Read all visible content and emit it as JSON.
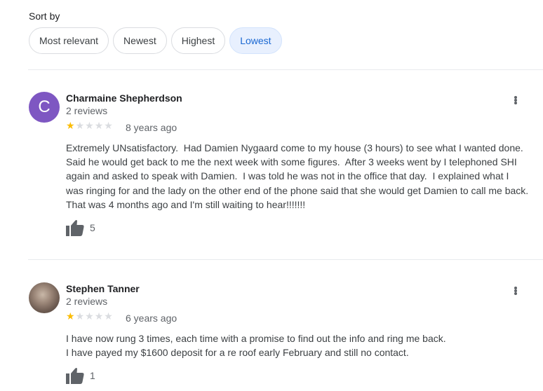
{
  "sort": {
    "label": "Sort by",
    "options": [
      "Most relevant",
      "Newest",
      "Highest",
      "Lowest"
    ],
    "selected": "Lowest"
  },
  "reviews": [
    {
      "avatar_letter": "C",
      "avatar_color": "#7e57c2",
      "name": "Charmaine Shepherdson",
      "review_count": "2 reviews",
      "rating": 1,
      "max_rating": 5,
      "date": "8 years ago",
      "text": "Extremely UNsatisfactory.  Had Damien Nygaard come to my house (3 hours) to see what I wanted done.  Said he would get back to me the next week with some figures.  After 3 weeks went by I telephoned SHI again and asked to speak with Damien.  I was told he was not in the office that day.  I explained what I was ringing for and the lady on the other end of the phone said that she would get Damien to call me back.  That was 4 months ago and I'm still waiting to hear!!!!!!!",
      "likes": "5"
    },
    {
      "avatar_icon": "photo-avatar",
      "name": "Stephen Tanner",
      "review_count": "2 reviews",
      "rating": 1,
      "max_rating": 5,
      "date": "6 years ago",
      "text": "I have now rung 3 times, each time with a promise to find out the info and ring me back.\nI have payed my $1600 deposit for a re roof early February and still no contact.",
      "likes": "1"
    }
  ],
  "colors": {
    "star_on": "#fbbc04",
    "star_off": "#dadce0",
    "chip_active_bg": "#e8f0fe",
    "chip_active_text": "#1967d2"
  }
}
